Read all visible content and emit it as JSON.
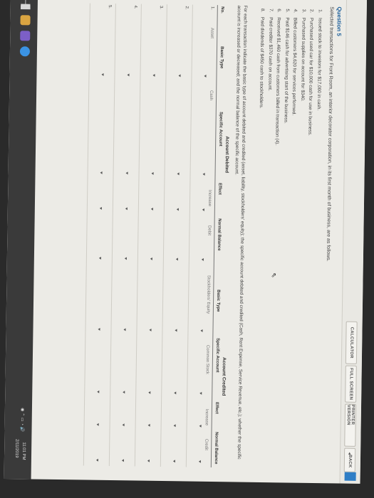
{
  "toolbar": {
    "calculator": "CALCULATOR",
    "full_screen": "FULL SCREEN",
    "printer_version": "PRINTER VERSION",
    "back": "BACK"
  },
  "question": {
    "title": "Question 5",
    "intro": "Selected transactions for Front Room, an interior decorator corporation, in its first month of business, are as follows.",
    "transactions": [
      {
        "num": "1.",
        "text": "Issued stock to investors for $17,000 in cash."
      },
      {
        "num": "2.",
        "text": "Purchased used car for $10,000 cash for use in business."
      },
      {
        "num": "3.",
        "text": "Purchased supplies on account for $340."
      },
      {
        "num": "4.",
        "text": "Billed customers $4,620 for services performed."
      },
      {
        "num": "5.",
        "text": "Paid $146 cash for advertising start of the business."
      },
      {
        "num": "6.",
        "text": "Received $1,460 cash from customers billed in transaction (4)."
      },
      {
        "num": "7.",
        "text": "Paid creditor $370 cash on account."
      },
      {
        "num": "8.",
        "text": "Paid dividends of $450 cash to stockholders."
      }
    ],
    "instructions": "For each transaction indicate the basic type of account debited and credited (asset, liability, stockholders' equity); the specific account debited and credited (Cash, Rent Expense, Service Revenue, etc.); whether the specific account is increased or decreased; and the normal balance of the specific account."
  },
  "table": {
    "group_debited": "Account Debited",
    "group_credited": "Account Credited",
    "headers": {
      "no": "No.",
      "basic_type": "Basic Type",
      "specific_account": "Specific Account",
      "effect": "Effect",
      "normal_balance": "Normal Balance",
      "basic_type_c": "Basic Type",
      "specific_account_c": "Specific Account",
      "effect_c": "Effect",
      "normal_balance_c": "Normal Balance"
    },
    "rows": [
      {
        "no": "1.",
        "basic_type": "Asset",
        "specific": "Cash",
        "effect": "Increase",
        "normal": "Debit",
        "basic_type_c": "Stockholders' Equity",
        "specific_c": "Common Stock",
        "effect_c": "Increase",
        "normal_c": "Credit"
      },
      {
        "no": "2.",
        "basic_type": "",
        "specific": "",
        "effect": "",
        "normal": "",
        "basic_type_c": "",
        "specific_c": "",
        "effect_c": "",
        "normal_c": ""
      },
      {
        "no": "3.",
        "basic_type": "",
        "specific": "",
        "effect": "",
        "normal": "",
        "basic_type_c": "",
        "specific_c": "",
        "effect_c": "",
        "normal_c": ""
      },
      {
        "no": "4.",
        "basic_type": "",
        "specific": "",
        "effect": "",
        "normal": "",
        "basic_type_c": "",
        "specific_c": "",
        "effect_c": "",
        "normal_c": ""
      },
      {
        "no": "5.",
        "basic_type": "",
        "specific": "",
        "effect": "",
        "normal": "",
        "basic_type_c": "",
        "specific_c": "",
        "effect_c": "",
        "normal_c": ""
      }
    ]
  },
  "taskbar": {
    "time": "11:01 PM",
    "date": "2/11/2019"
  },
  "colors": {
    "accent": "#2f7ec6",
    "title": "#1d5f9a"
  }
}
